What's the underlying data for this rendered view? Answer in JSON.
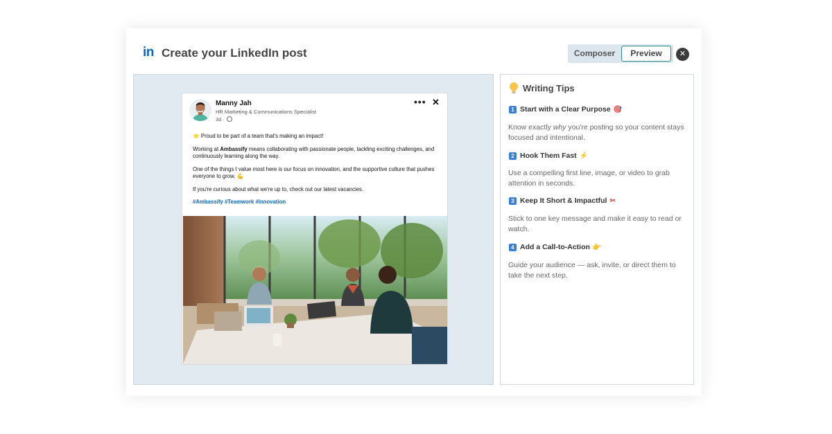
{
  "header": {
    "logo_text": "in",
    "title": "Create your LinkedIn post",
    "tabs": [
      {
        "label": "Composer",
        "active": false
      },
      {
        "label": "Preview",
        "active": true
      }
    ],
    "close_label": "✕"
  },
  "post": {
    "author_name": "Manny Jah",
    "author_role": "HR Marketing & Communications Specialist",
    "time": "3d",
    "more_label": "•••",
    "close_label": "✕",
    "line1": "⭐ Proud to be part of a team that's making an impact!",
    "para2_pre": "Working at ",
    "para2_bold": "Ambassify",
    "para2_post": " means collaborating with passionate people, tackling exciting challenges, and continuously learning along the way.",
    "para3": "One of the things I value most here is our focus on innovation, and the supportive culture that pushes everyone to grow. 💪",
    "para4": "If you're curious about what we're up to, check out our latest vacancies.",
    "hashtags": [
      "#Ambassify",
      "#Teamwork",
      "#Innovation"
    ]
  },
  "tips": {
    "title": "Writing Tips",
    "items": [
      {
        "num": "1",
        "heading": "Start with a Clear Purpose",
        "emoji": "🎯",
        "text_pre": "Know exactly ",
        "text_em": "why",
        "text_post": " you're posting so your content stays focused and intentional."
      },
      {
        "num": "2",
        "heading": "Hook Them Fast",
        "emoji": "⚡",
        "text": "Use a compelling first line, image, or video to grab attention in seconds."
      },
      {
        "num": "3",
        "heading": "Keep It Short & Impactful",
        "emoji": "✂",
        "text": "Stick to one key message and make it easy to read or watch."
      },
      {
        "num": "4",
        "heading": "Add a Call-to-Action",
        "emoji": "👉",
        "text": "Guide your audience — ask, invite, or direct them to take the next step."
      }
    ]
  },
  "colors": {
    "linkedin_blue": "#0a66c2",
    "accent_green": "#2a8b7a",
    "preview_bg": "#e2eaf1"
  }
}
